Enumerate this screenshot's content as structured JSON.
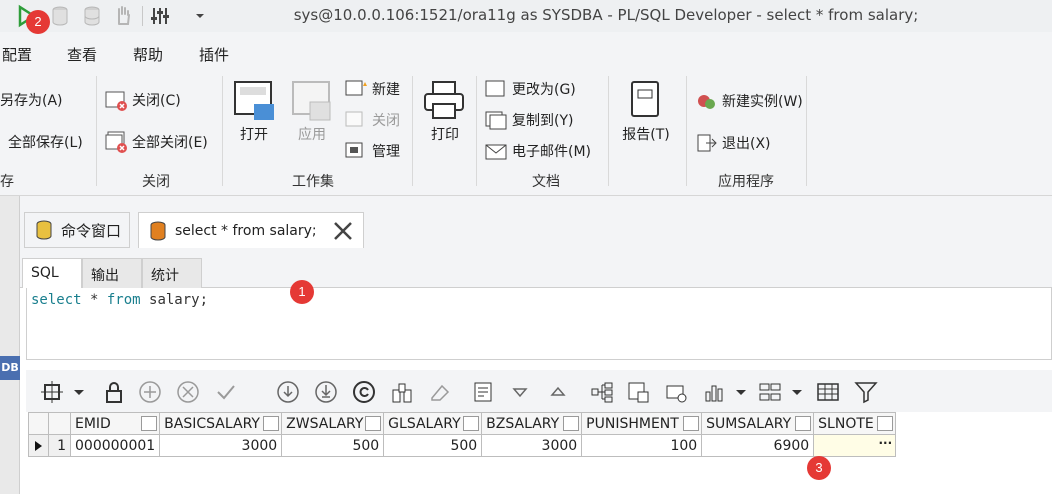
{
  "window": {
    "title": "sys@10.0.0.106:1521/ora11g as SYSDBA - PL/SQL Developer - select * from salary;"
  },
  "menu": {
    "items": [
      "配置",
      "查看",
      "帮助",
      "插件"
    ]
  },
  "ribbon": {
    "save_group": {
      "save_as": "另存为(A)",
      "save_all": "全部保存(L)",
      "label": "存"
    },
    "close_group": {
      "close": "关闭(C)",
      "close_all": "全部关闭(E)",
      "label": "关闭"
    },
    "workset_group": {
      "open": "打开",
      "apply": "应用",
      "new": "新建",
      "close": "关闭",
      "manage": "管理",
      "label": "工作集"
    },
    "print": "打印",
    "doc_group": {
      "change_to": "更改为(G)",
      "copy_to": "复制到(Y)",
      "email": "电子邮件(M)",
      "label": "文档"
    },
    "report": "报告(T)",
    "app_group": {
      "new_instance": "新建实例(W)",
      "exit": "退出(X)",
      "label": "应用程序"
    }
  },
  "left_strip": {
    "label": "DB"
  },
  "doc_tabs": [
    {
      "label": "命令窗口"
    },
    {
      "label": "select * from salary;"
    }
  ],
  "sub_tabs": [
    {
      "label": "SQL",
      "active": true
    },
    {
      "label": "输出"
    },
    {
      "label": "统计"
    }
  ],
  "editor": {
    "sql": {
      "kw1": "select",
      "star": " * ",
      "kw2": "from",
      "rest": " salary;"
    }
  },
  "grid": {
    "columns": [
      "EMID",
      "BASICSALARY",
      "ZWSALARY",
      "GLSALARY",
      "BZSALARY",
      "PUNISHMENT",
      "SUMSALARY",
      "SLNOTE"
    ],
    "rows": [
      {
        "num": "1",
        "cells": [
          "000000001",
          "3000",
          "500",
          "500",
          "3000",
          "100",
          "6900",
          ""
        ]
      }
    ],
    "ellipsis": "···"
  },
  "badges": {
    "b1": "1",
    "b2": "2",
    "b3": "3"
  },
  "colors": {
    "keyword": "#1a7f8e",
    "badge": "#e53935",
    "run": "#2e9d3a"
  }
}
